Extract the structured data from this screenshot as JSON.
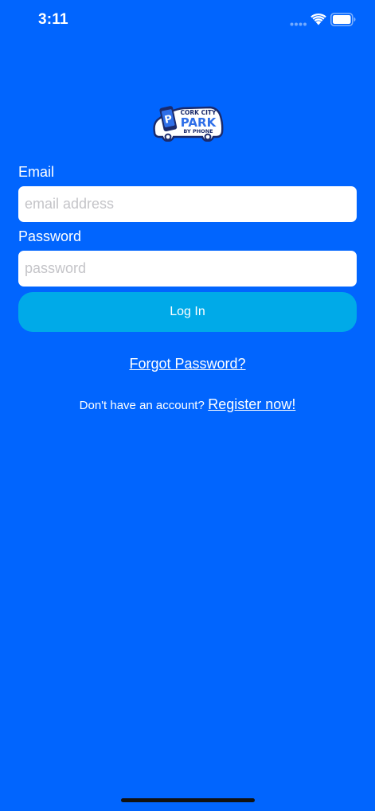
{
  "status_bar": {
    "time": "3:11"
  },
  "logo": {
    "line1": "CORK CITY",
    "line2": "PARK",
    "line3": "BY PHONE",
    "badge": "P"
  },
  "form": {
    "email_label": "Email",
    "email_placeholder": "email address",
    "email_value": "",
    "password_label": "Password",
    "password_placeholder": "password",
    "password_value": "",
    "login_label": "Log In"
  },
  "links": {
    "forgot_password": "Forgot Password?",
    "register_prompt": "Don't have an account?",
    "register_now": "Register now!"
  },
  "colors": {
    "background": "#0165FE",
    "button": "#00AAE8",
    "input_bg": "#FFFFFF",
    "logo_navy": "#1A2A6C",
    "logo_blue": "#2F6FE8"
  }
}
